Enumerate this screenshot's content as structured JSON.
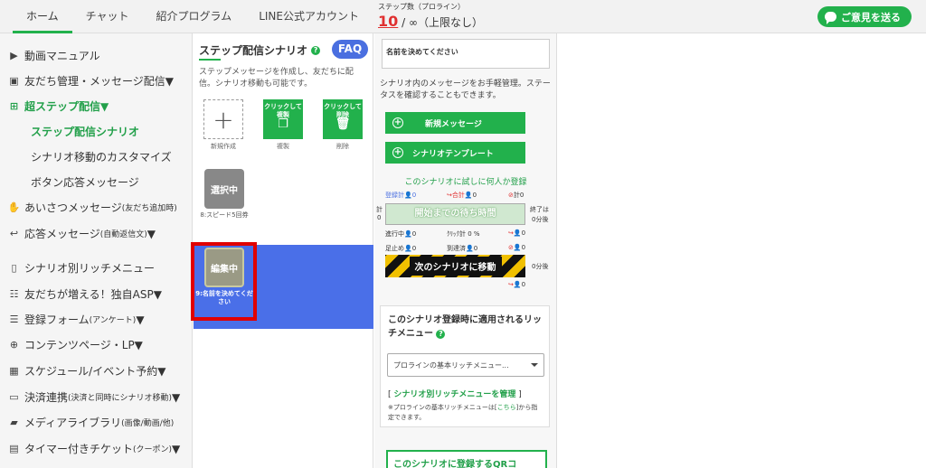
{
  "nav": {
    "items": [
      "ホーム",
      "チャット",
      "紹介プログラム",
      "LINE公式アカウント"
    ],
    "active_index": 0
  },
  "steps": {
    "label": "ステップ数（プロライン）",
    "count": "10",
    "rest": "/ ∞（上限なし）"
  },
  "feedback_button": "ご意見を送る",
  "sidebar": {
    "items": [
      {
        "icon": "video-icon",
        "label": "動画マニュアル"
      },
      {
        "icon": "contacts-icon",
        "label": "友だち管理・メッセージ配信▼"
      },
      {
        "icon": "sitemap-icon",
        "label": "超ステップ配信▼"
      },
      {
        "icon": "hand-wave-icon",
        "label": "あいさつメッセージ",
        "small": "(友だち追加時)"
      },
      {
        "icon": "reply-icon",
        "label": "応答メッセージ",
        "small": "(自動返信文)",
        "suffix": "▼"
      },
      {
        "icon": "mobile-icon",
        "label": "シナリオ別リッチメニュー"
      },
      {
        "icon": "handshake-icon",
        "label": "友だちが増える！独自ASP▼"
      },
      {
        "icon": "list-icon",
        "label": "登録フォーム",
        "small": "(アンケート)",
        "suffix": "▼"
      },
      {
        "icon": "globe-icon",
        "label": "コンテンツページ・LP▼"
      },
      {
        "icon": "calendar-icon",
        "label": "スケジュール/イベント予約▼"
      },
      {
        "icon": "credit-card-icon",
        "label": "決済連携",
        "small": "(決済と同時にシナリオ移動)",
        "suffix": "▼"
      },
      {
        "icon": "folder-icon",
        "label": "メディアライブラリ",
        "small": "(画像/動画/他)"
      },
      {
        "icon": "ticket-icon",
        "label": "タイマー付きチケット",
        "small": "(クーポン)",
        "suffix": "▼"
      }
    ],
    "sub_items": [
      "ステップ配信シナリオ",
      "シナリオ移動のカスタマイズ",
      "ボタン応答メッセージ"
    ]
  },
  "scenario": {
    "title": "ステップ配信シナリオ",
    "faq": "FAQ",
    "description": "ステップメッセージを作成し、友だちに配信。シナリオ移動も可能です。",
    "tools": {
      "new_label": "新規作成",
      "copy_box": "クリックして複製",
      "copy_label": "複製",
      "delete_box": "クリックして削除",
      "delete_label": "削除"
    },
    "selected_tile": "選択中",
    "selected_caption": "8:スピード5回券",
    "editing_tile": "編集中",
    "editing_caption": "9:名前を決めてください"
  },
  "detail": {
    "name_value": "名前を決めてください",
    "description": "シナリオ内のメッセージをお手軽管理。ステータスを確認することもできます。",
    "new_message": "新規メッセージ",
    "template": "シナリオテンプレート",
    "trial": "このシナリオに試しに何人か登録",
    "stats": {
      "registered": "登録計",
      "total": "合計",
      "blocked_zero": "0",
      "zero": "0",
      "total_prefix": "計",
      "end": "終了は",
      "zero_after": "0分後",
      "in_progress": "進行中",
      "click_total": "ｸﾘｯｸ計",
      "click_rate": "0 %",
      "stopped": "足止め",
      "reached": "到達済"
    },
    "wait_button": "開始までの待ち時間",
    "next_button": "次のシナリオに移動",
    "rich": {
      "title": "このシナリオ登録時に適用されるリッチメニュー",
      "select": "プロラインの基本リッチメニュー...",
      "manage": "シナリオ別リッチメニューを管理",
      "note_a": "※プロラインの基本リッチメニューは[",
      "note_link": "こちら",
      "note_b": "]から指定できます。"
    },
    "qr_button": "このシナリオに登録するQRコ"
  }
}
